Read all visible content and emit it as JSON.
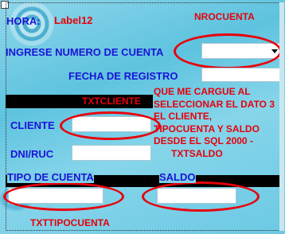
{
  "labels": {
    "hora": "HORA:",
    "label12": "Label12",
    "ingrese": "INGRESE NUMERO DE CUENTA",
    "fecha": "FECHA DE REGISTRO",
    "cliente": "CLIENTE",
    "dni": "DNI/RUC",
    "tipo": "TIPO DE CUENTA",
    "saldo": "SALDO"
  },
  "annotations": {
    "nrocuenta": "NROCUENTA",
    "txtcliente": "TXTCLIENTE",
    "note1": "QUE ME CARGUE AL",
    "note2": "SELECCIONAR EL DATO 3",
    "note3": "EL CLIENTE,",
    "note4": "TIPOCUENTA Y SALDO",
    "note5": "DESDE EL SQL 2000 -",
    "note6": "TXTSALDO",
    "txttipocuenta": "TXTTIPOCUENTA"
  },
  "colors": {
    "label_blue": "#1a14d6",
    "annotation_red": "#e8000b"
  }
}
